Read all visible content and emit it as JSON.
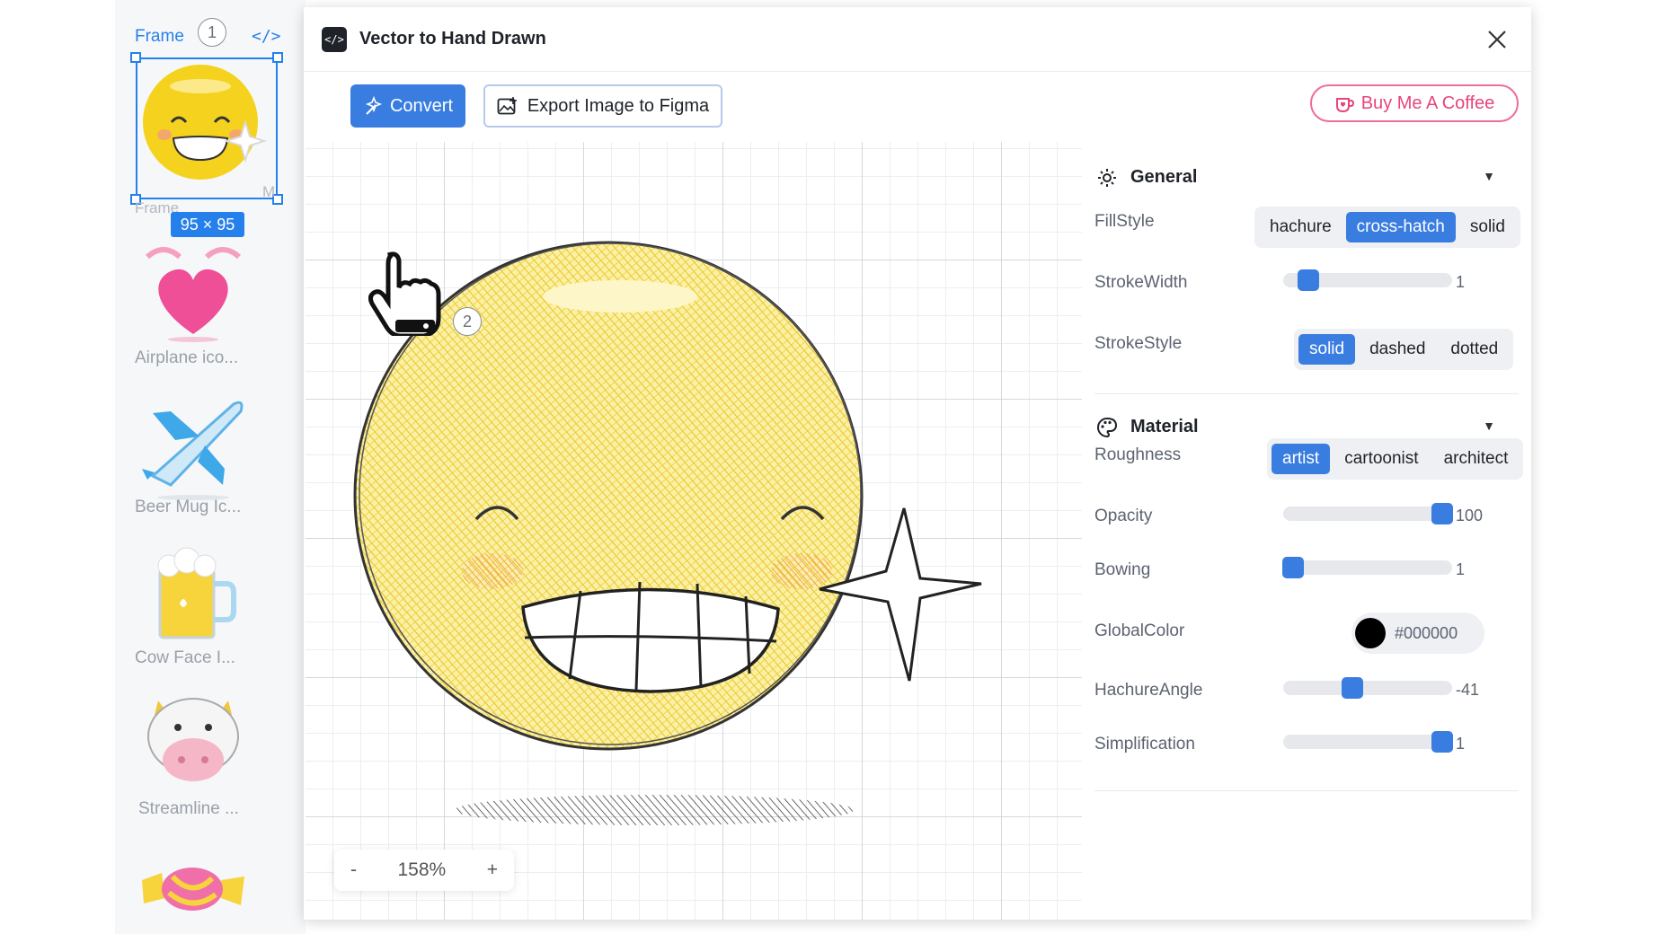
{
  "layers": {
    "frame_label": "Frame",
    "step1": "1",
    "code_icon_text": "</>",
    "size_tag": "95 × 95",
    "ghost_label": "Frame",
    "ghost_m": "M",
    "items": [
      {
        "label": "Airplane ico..."
      },
      {
        "label": "Beer Mug Ic..."
      },
      {
        "label": "Cow Face I..."
      },
      {
        "label": "Streamline ..."
      }
    ]
  },
  "plugin": {
    "icon_text": "</>",
    "title": "Vector to Hand Drawn",
    "convert_label": "Convert",
    "export_label": "Export Image to Figma",
    "coffee_label": "Buy Me A Coffee",
    "step2": "2"
  },
  "canvas": {
    "zoom_minus": "-",
    "zoom_level": "158%",
    "zoom_plus": "+"
  },
  "settings": {
    "general": {
      "title": "General",
      "fill_style": {
        "label": "FillStyle",
        "options": [
          "hachure",
          "cross-hatch",
          "solid"
        ],
        "selected": "cross-hatch"
      },
      "stroke_width": {
        "label": "StrokeWidth",
        "value": "1",
        "fraction": 0.15
      },
      "stroke_style": {
        "label": "StrokeStyle",
        "options": [
          "solid",
          "dashed",
          "dotted"
        ],
        "selected": "solid"
      }
    },
    "material": {
      "title": "Material",
      "roughness": {
        "label": "Roughness",
        "options": [
          "artist",
          "cartoonist",
          "architect"
        ],
        "selected": "artist"
      },
      "opacity": {
        "label": "Opacity",
        "value": "100",
        "fraction": 0.94
      },
      "bowing": {
        "label": "Bowing",
        "value": "1",
        "fraction": 0.06
      },
      "global_color": {
        "label": "GlobalColor",
        "value": "#000000"
      },
      "hachure_angle": {
        "label": "HachureAngle",
        "value": "-41",
        "fraction": 0.41
      },
      "simplification": {
        "label": "Simplification",
        "value": "1",
        "fraction": 0.94
      }
    }
  },
  "colors": {
    "accent": "#3a7de0",
    "figma_blue": "#2680eb",
    "coffee_pink": "#e8457c",
    "emoji_yellow": "#f7d93a"
  }
}
